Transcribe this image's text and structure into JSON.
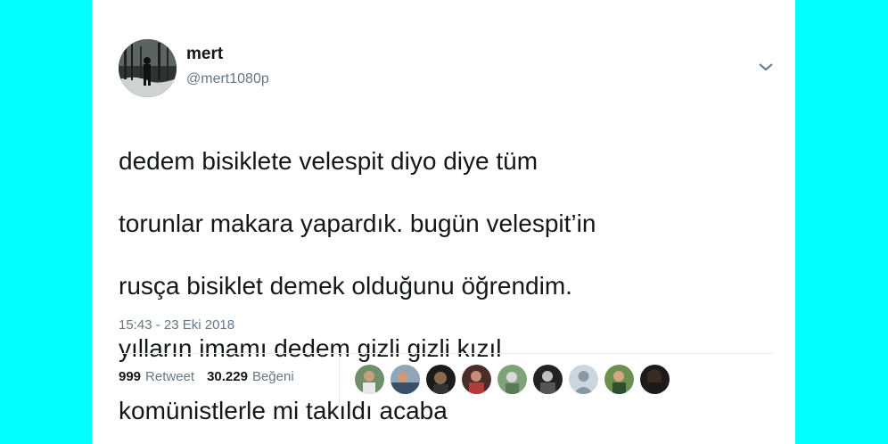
{
  "tweet": {
    "display_name": "mert",
    "handle": "@mert1080p",
    "text_lines": [
      "dedem bisiklete velespit diyo diye tüm",
      "torunlar makara yapardık. bugün velespit’in",
      "rusça bisiklet demek olduğunu öğrendim.",
      "yılların imamı dedem gizli gizli kızıl",
      "komünistlerle mi takıldı acaba"
    ],
    "timestamp": "15:43 - 23 Eki 2018",
    "retweet_count": "999",
    "retweet_label": "Retweet",
    "like_count": "30.229",
    "like_label": "Beğeni"
  },
  "icons": {
    "caret": "chevron-down-icon"
  },
  "colors": {
    "background": "#00ffff",
    "card": "#ffffff",
    "text_primary": "#14171a",
    "text_secondary": "#657786",
    "divider": "#e6ecf0"
  }
}
